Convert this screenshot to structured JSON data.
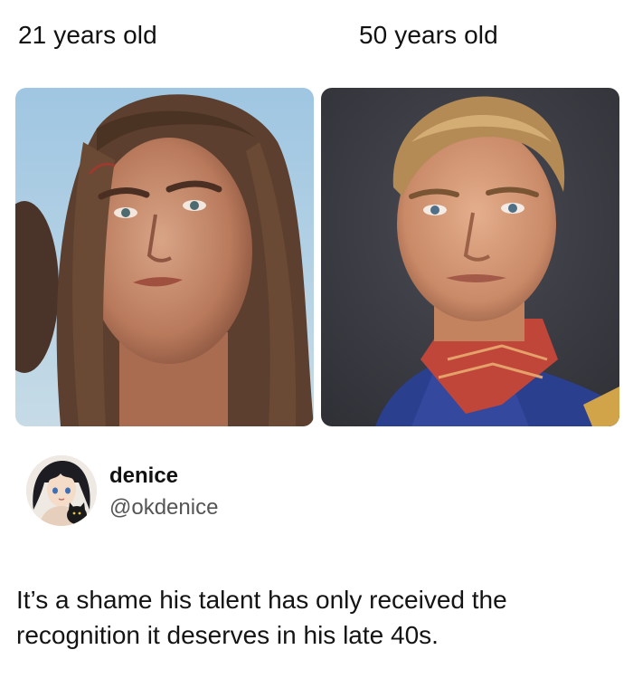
{
  "captions": {
    "left": "21 years old",
    "right": "50 years old"
  },
  "photos": {
    "left_icon": "photo-young-man-long-hair",
    "right_icon": "photo-man-blond-hero-costume"
  },
  "tweet": {
    "display_name": "denice",
    "handle": "@okdenice",
    "avatar_icon": "avatar-anime-girl-with-cat",
    "text": "It’s a shame his talent has only received the recognition it deserves in his late 40s."
  },
  "colors": {
    "sky_blue": "#a9cbe0",
    "studio_gray": "#3c3d44",
    "costume_blue": "#2b3f8f",
    "collar_red": "#c0463a"
  }
}
